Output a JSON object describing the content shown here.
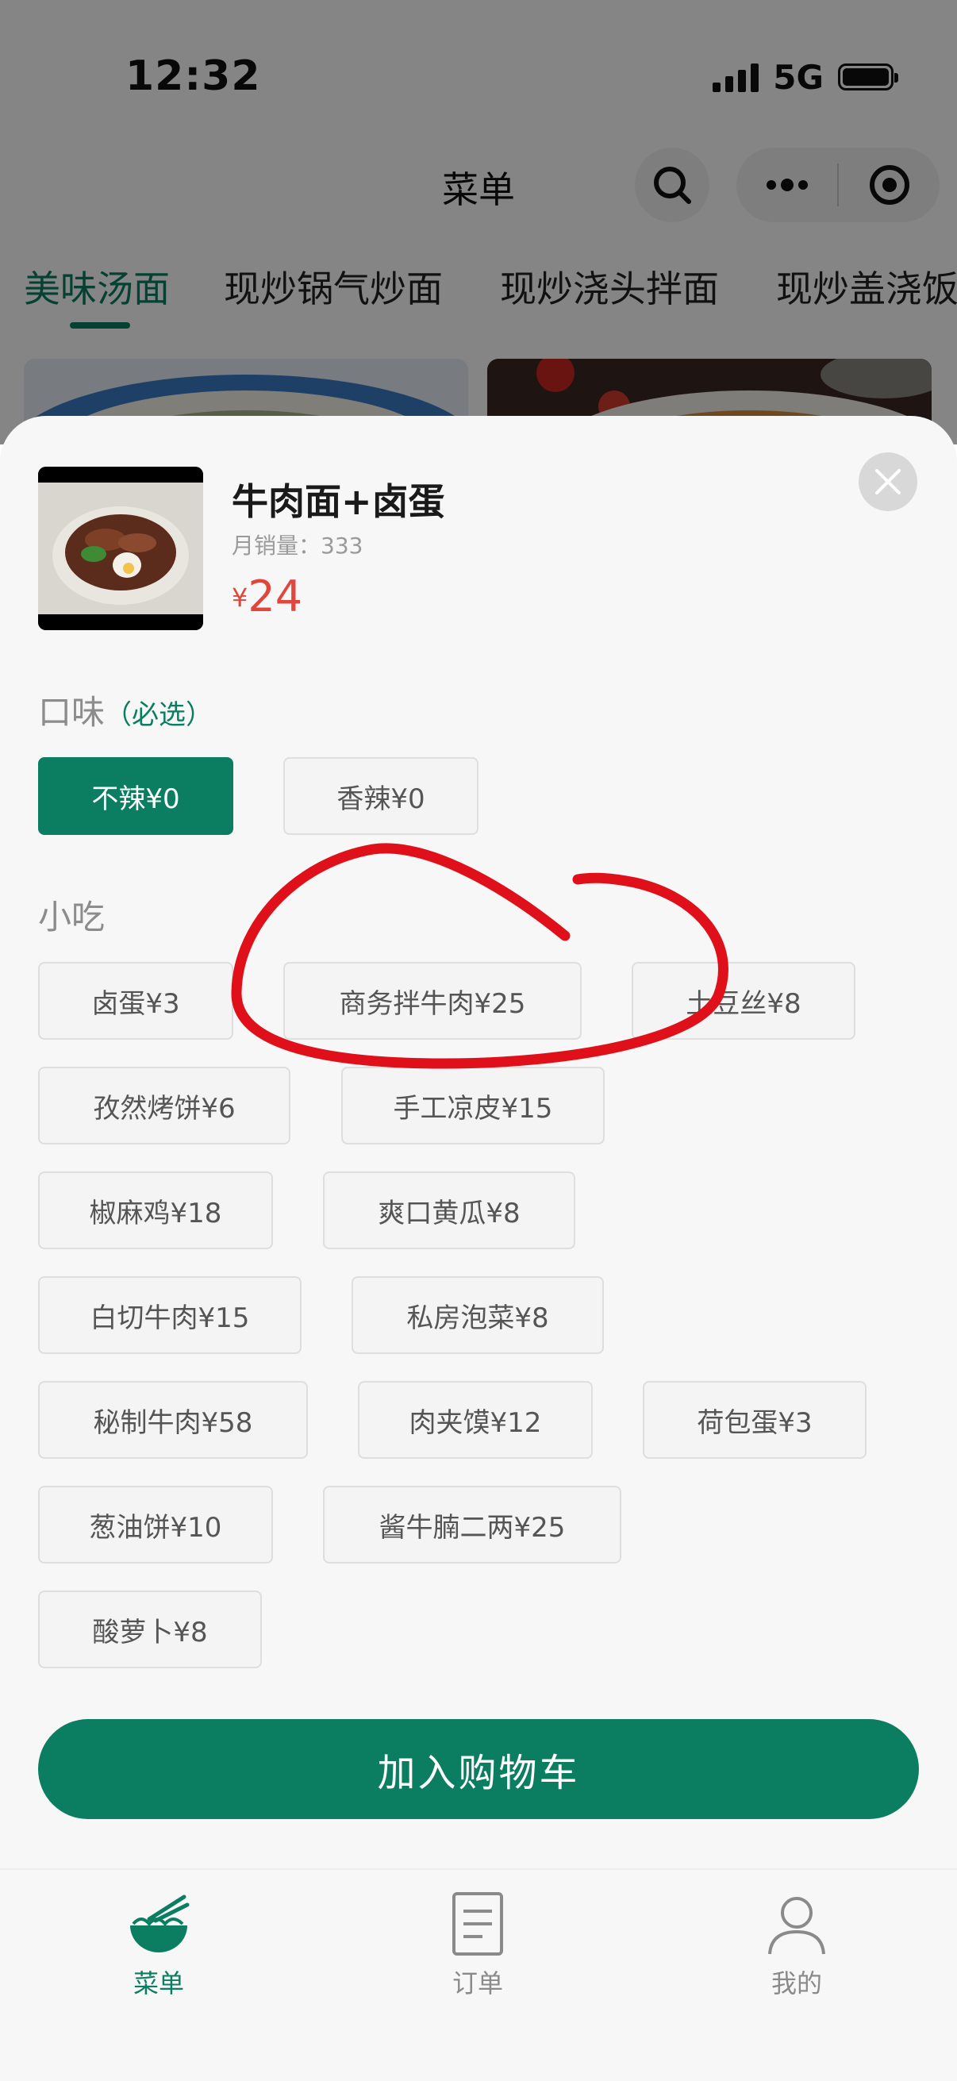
{
  "status_bar": {
    "time": "12:32",
    "network": "5G"
  },
  "header": {
    "title": "菜单"
  },
  "category_tabs": [
    "美味汤面",
    "现炒锅气炒面",
    "现炒浇头拌面",
    "现炒盖浇饭"
  ],
  "product": {
    "name": "牛肉面+卤蛋",
    "sales_label": "月销量：",
    "sales_value": "333",
    "currency": "¥",
    "price": "24"
  },
  "flavor": {
    "title": "口味",
    "required": "（必选）",
    "options": [
      {
        "label": "不辣¥0",
        "selected": true
      },
      {
        "label": "香辣¥0",
        "selected": false
      }
    ]
  },
  "snacks": {
    "title": "小吃",
    "options": [
      "卤蛋¥3",
      "商务拌牛肉¥25",
      "土豆丝¥8",
      "孜然烤饼¥6",
      "手工凉皮¥15",
      "椒麻鸡¥18",
      "爽口黄瓜¥8",
      "白切牛肉¥15",
      "私房泡菜¥8",
      "秘制牛肉¥58",
      "肉夹馍¥12",
      "荷包蛋¥3",
      "葱油饼¥10",
      "酱牛腩二两¥25",
      "酸萝卜¥8"
    ]
  },
  "add_to_cart": "加入购物车",
  "tabbar": [
    {
      "label": "菜单",
      "icon": "noodle-bowl-icon",
      "active": true
    },
    {
      "label": "订单",
      "icon": "order-document-icon",
      "active": false
    },
    {
      "label": "我的",
      "icon": "profile-person-icon",
      "active": false
    }
  ],
  "colors": {
    "brand": "#0b7d60",
    "price": "#e0463b",
    "annotation": "#e0101a"
  }
}
